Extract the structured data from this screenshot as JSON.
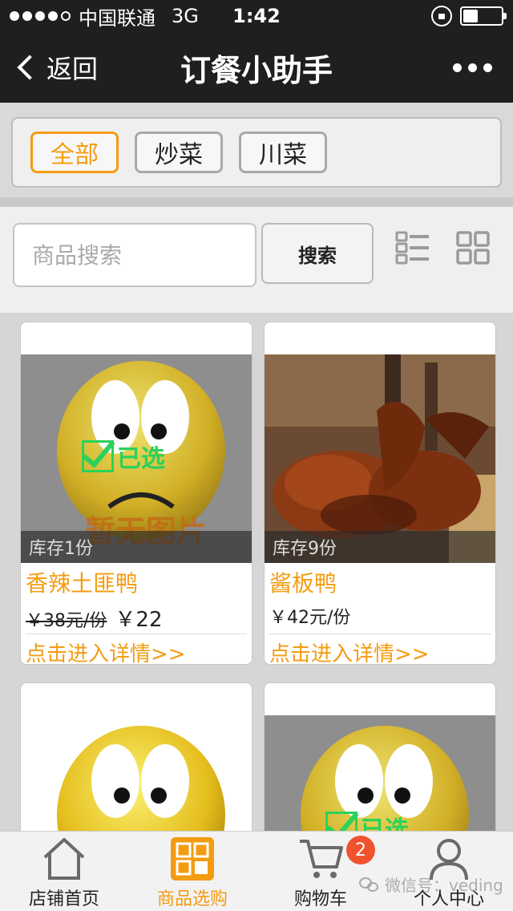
{
  "status_bar": {
    "carrier": "中国联通",
    "network": "3G",
    "time": "1:42",
    "battery_level": 0.35,
    "signal_bars_filled": 4,
    "signal_bars_total": 5
  },
  "nav": {
    "back_label": "返回",
    "title": "订餐小助手",
    "more_icon": "more-dots-icon"
  },
  "categories": [
    {
      "label": "全部",
      "active": true
    },
    {
      "label": "炒菜",
      "active": false
    },
    {
      "label": "川菜",
      "active": false
    }
  ],
  "search": {
    "placeholder": "商品搜索",
    "value": "",
    "button_label": "搜索"
  },
  "view_icons": [
    "list-view-icon",
    "grid-view-icon"
  ],
  "products": [
    {
      "stock": "库存1份",
      "name": "香辣土匪鸭",
      "old_price": "￥38元/份",
      "new_price": "￥22",
      "detail_link": "点击进入详情>>",
      "image": "no-image-placeholder",
      "placeholder_text": "暂无图片",
      "selected_label": "已选"
    },
    {
      "stock": "库存9份",
      "name": "酱板鸭",
      "price": "￥42元/份",
      "detail_link": "点击进入详情>>",
      "image": "braised-duck-photo"
    }
  ],
  "tabs": [
    {
      "label": "店铺首页",
      "icon": "home-icon",
      "active": false
    },
    {
      "label": "商品选购",
      "icon": "grid-shop-icon",
      "active": true
    },
    {
      "label": "购物车",
      "icon": "cart-icon",
      "active": false
    },
    {
      "label": "个人中心",
      "icon": "user-icon",
      "active": false
    }
  ],
  "cart_badge": "2",
  "watermark": "微信号：veding",
  "colors": {
    "accent": "#f39c12",
    "bar_bg": "#1f1f1f",
    "badge": "#f0522e",
    "selected": "#2bd15a"
  }
}
